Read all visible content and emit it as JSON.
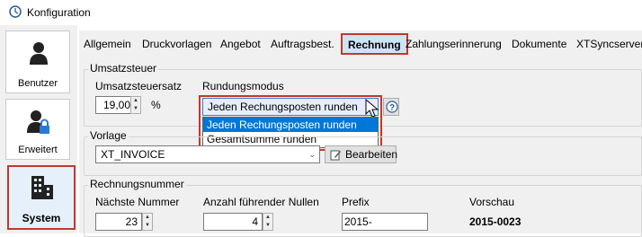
{
  "window": {
    "title": "Konfiguration"
  },
  "sidebar": {
    "items": [
      {
        "label": "Benutzer",
        "icon": "user-icon"
      },
      {
        "label": "Erweitert",
        "icon": "user-lock-icon"
      },
      {
        "label": "System",
        "icon": "building-icon",
        "active": true
      }
    ]
  },
  "tabs": [
    {
      "label": "Allgemein"
    },
    {
      "label": "Druckvorlagen"
    },
    {
      "label": "Angebot"
    },
    {
      "label": "Auftragsbest."
    },
    {
      "label": "Rechnung",
      "active": true
    },
    {
      "label": "Zahlungserinnerung"
    },
    {
      "label": "Dokumente"
    },
    {
      "label": "XTSyncserver"
    }
  ],
  "umsatzsteuer": {
    "group_label": "Umsatzsteuer",
    "rate_label": "Umsatzsteuersatz",
    "rate_value": "19,00",
    "percent_sign": "%",
    "rounding_label": "Rundungsmodus",
    "rounding_selected": "Jeden Rechungsposten runden",
    "rounding_options": [
      "Jeden Rechungsposten runden",
      "Gesamtsumme runden"
    ]
  },
  "vorlage": {
    "group_label": "Vorlage",
    "selected": "XT_INVOICE",
    "edit_button": "Bearbeiten"
  },
  "rechnungsnummer": {
    "group_label": "Rechnungsnummer",
    "next_label": "Nächste Nummer",
    "next_value": "23",
    "zeros_label": "Anzahl führender Nullen",
    "zeros_value": "4",
    "prefix_label": "Prefix",
    "prefix_value": "2015-",
    "preview_label": "Vorschau",
    "preview_value": "2015-0023"
  },
  "colors": {
    "highlight": "#c0392b",
    "accent": "#0078d7",
    "active_tab_bg": "#cfe3f7"
  }
}
